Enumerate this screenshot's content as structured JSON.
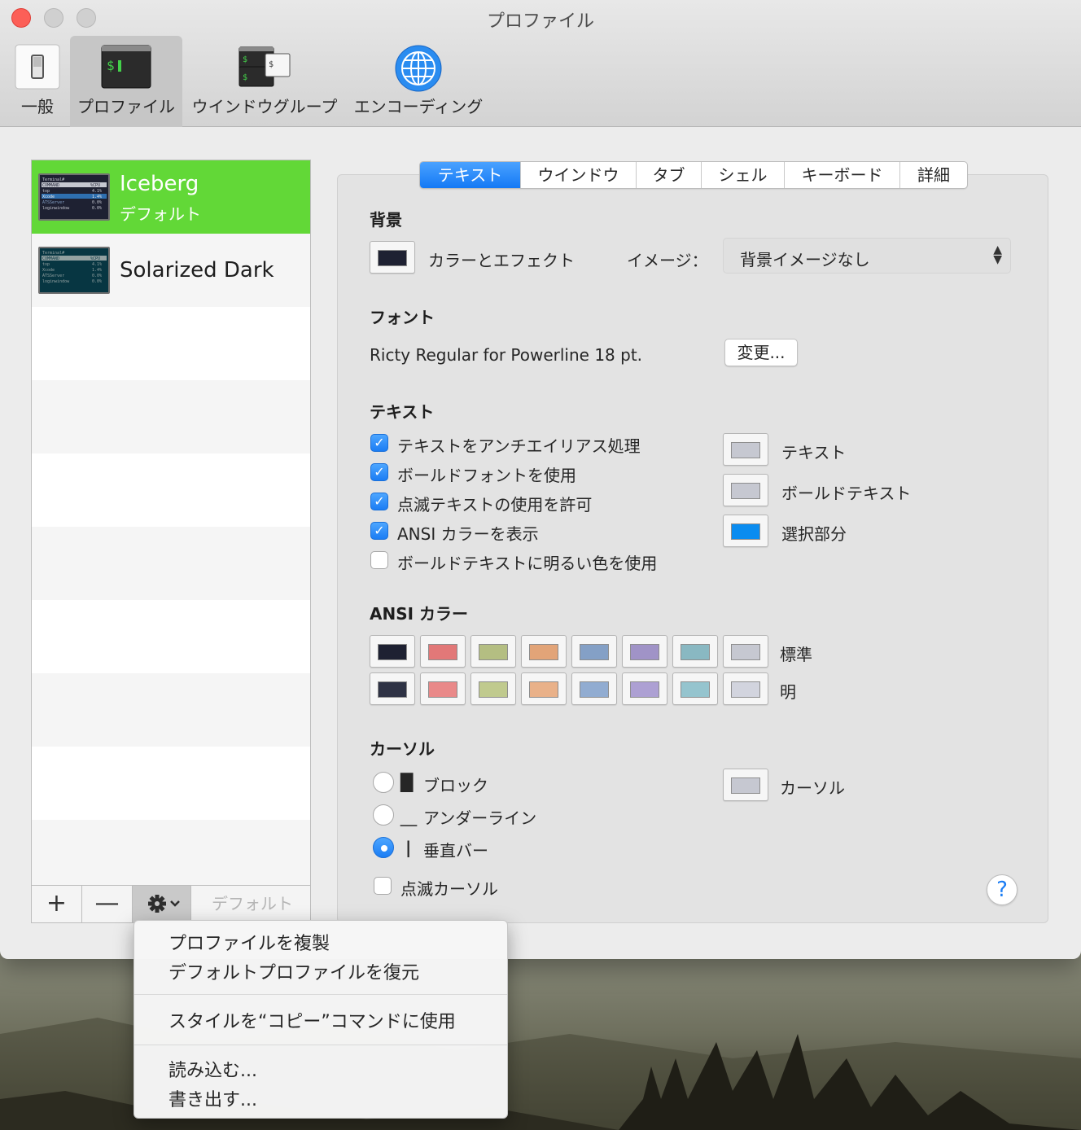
{
  "window": {
    "title": "プロファイル"
  },
  "toolbar": [
    {
      "label": "一般",
      "icon": "switch-icon"
    },
    {
      "label": "プロファイル",
      "icon": "terminal-icon"
    },
    {
      "label": "ウインドウグループ",
      "icon": "window-group-icon"
    },
    {
      "label": "エンコーディング",
      "icon": "globe-icon"
    }
  ],
  "profiles": [
    {
      "name": "Iceberg",
      "subtitle": "デフォルト",
      "selected": true
    },
    {
      "name": "Solarized Dark",
      "subtitle": "",
      "selected": false
    }
  ],
  "profile_thumb_lines": [
    "Terminal#",
    "COMMAND",
    "%CPU",
    "top",
    "4.1%",
    "Xcode",
    "1.4%",
    "ATSServer",
    "0.0%",
    "loginwindow",
    "0.0%"
  ],
  "sidebar_buttons": {
    "add": "+",
    "remove": "—",
    "default": "デフォルト"
  },
  "tabs": [
    {
      "label": "テキスト",
      "active": true
    },
    {
      "label": "ウインドウ",
      "active": false
    },
    {
      "label": "タブ",
      "active": false
    },
    {
      "label": "シェル",
      "active": false
    },
    {
      "label": "キーボード",
      "active": false
    },
    {
      "label": "詳細",
      "active": false
    }
  ],
  "background": {
    "section": "背景",
    "color_label": "カラーとエフェクト",
    "image_label": "イメージ：",
    "image_value": "背景イメージなし"
  },
  "font": {
    "section": "フォント",
    "value": "Ricty Regular for Powerline 18 pt.",
    "change_button": "変更..."
  },
  "text": {
    "section": "テキスト",
    "checkboxes": [
      {
        "label": "テキストをアンチエイリアス処理",
        "checked": true
      },
      {
        "label": "ボールドフォントを使用",
        "checked": true
      },
      {
        "label": "点滅テキストの使用を許可",
        "checked": true
      },
      {
        "label": "ANSI カラーを表示",
        "checked": true
      },
      {
        "label": "ボールドテキストに明るい色を使用",
        "checked": false
      }
    ],
    "color_wells": [
      {
        "label": "テキスト",
        "color": "#c6c8d1"
      },
      {
        "label": "ボールドテキスト",
        "color": "#c6c8d1"
      },
      {
        "label": "選択部分",
        "color": "#0a8cf0"
      }
    ]
  },
  "ansi": {
    "section": "ANSI カラー",
    "normal_label": "標準",
    "bright_label": "明",
    "normal": [
      "#1e2132",
      "#e27878",
      "#b4be82",
      "#e2a478",
      "#84a0c6",
      "#a093c7",
      "#89b8c2",
      "#c6c8d1"
    ],
    "bright": [
      "#2e3244",
      "#e98989",
      "#c0ca8e",
      "#e9b189",
      "#91acd1",
      "#ada0d3",
      "#95c4ce",
      "#d2d4de"
    ]
  },
  "cursor": {
    "section": "カーソル",
    "options": [
      {
        "glyph": "█",
        "label": "ブロック",
        "selected": false
      },
      {
        "glyph": "＿",
        "label": "アンダーライン",
        "selected": false
      },
      {
        "glyph": "|",
        "label": "垂直バー",
        "selected": true
      }
    ],
    "blink_label": "点滅カーソル",
    "blink_checked": false,
    "well_label": "カーソル",
    "well_color": "#c6c8d1"
  },
  "help_label": "?",
  "action_menu": {
    "groups": [
      [
        "プロファイルを複製",
        "デフォルトプロファイルを復元"
      ],
      [
        "スタイルを“コピー”コマンドに使用"
      ],
      [
        "読み込む...",
        "書き出す..."
      ]
    ]
  },
  "colors": {
    "selected_row": "#62d837",
    "accent": "#1b7df4"
  }
}
